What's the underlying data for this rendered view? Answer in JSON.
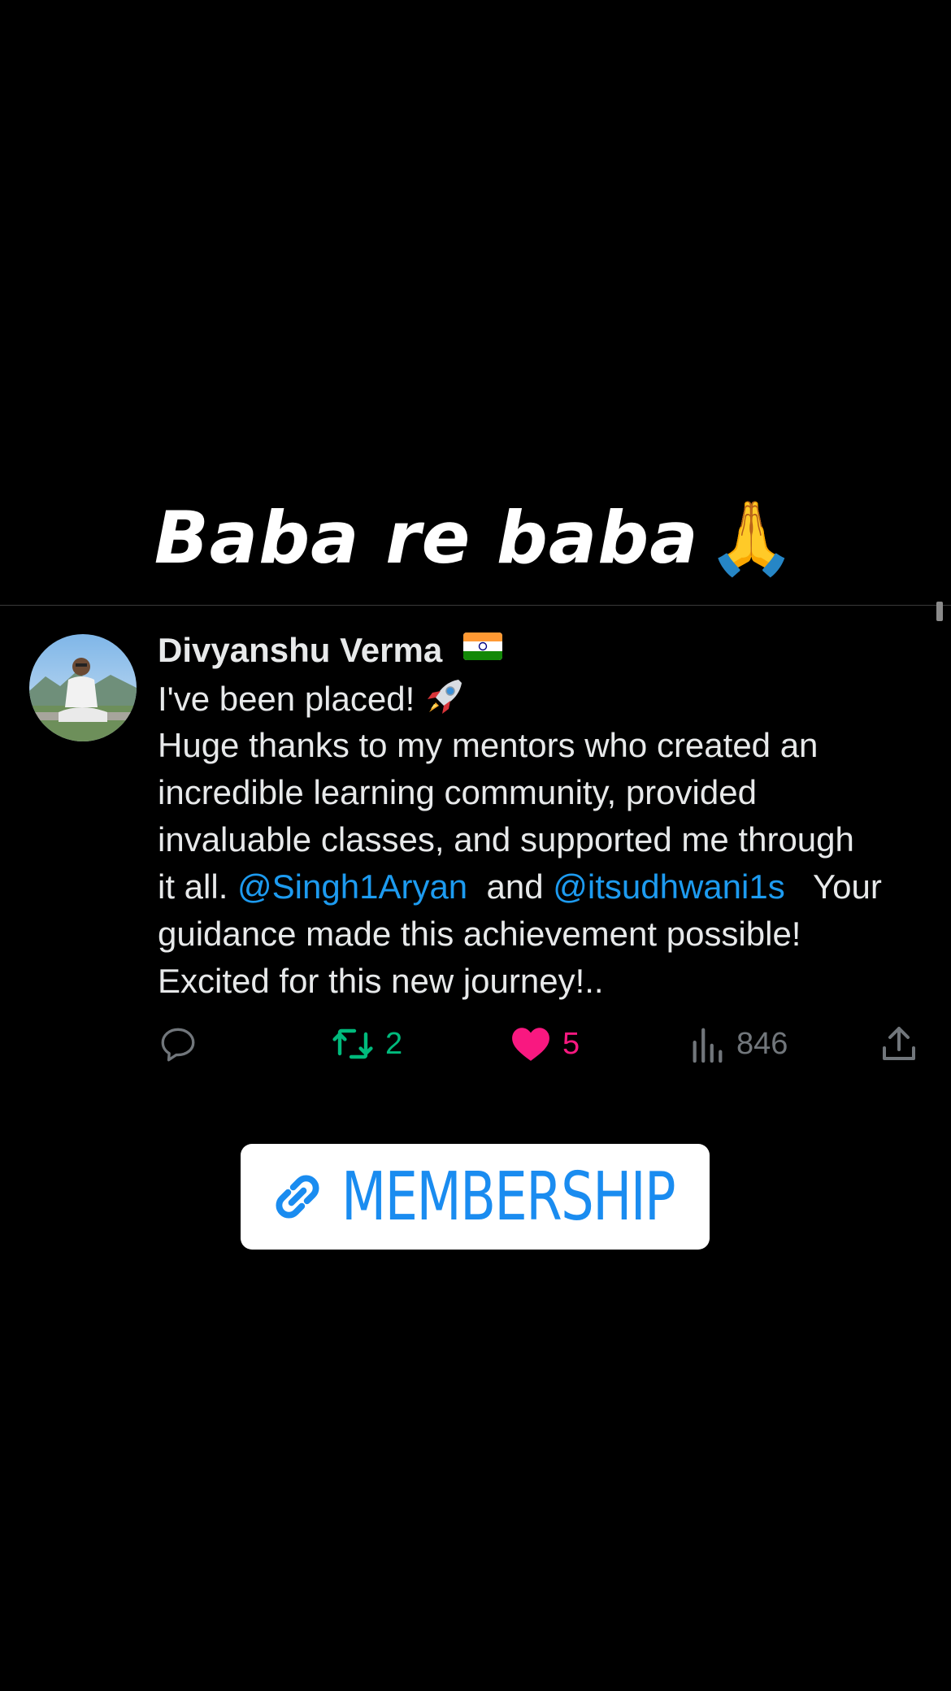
{
  "caption": {
    "text": "Baba re baba",
    "emoji": "🙏"
  },
  "tweet": {
    "author_name": "Divyanshu Verma",
    "author_flag_icon": "india-flag-icon",
    "text_line1": "I've been placed!",
    "text_line2": " Huge thanks to my mentors who created an",
    "text_line3": "incredible learning community, provided",
    "text_line4": "invaluable classes, and supported me through",
    "text_line5_prefix": "it all. ",
    "mention1": "@Singh1Aryan",
    "text_line5_mid": "  and ",
    "mention2": "@itsudhwani1s",
    "text_line5_suffix": "   Your",
    "text_line6": "guidance made this achievement possible!",
    "text_line7": "Excited for this new journey!.."
  },
  "actions": {
    "reply_icon": "reply-icon",
    "retweet_icon": "retweet-icon",
    "retweet_count": "2",
    "like_icon": "heart-icon",
    "like_count": "5",
    "views_icon": "views-icon",
    "views_count": "846",
    "share_icon": "share-icon"
  },
  "membership_button": {
    "label": "MEMBERSHIP",
    "icon": "link-icon"
  },
  "colors": {
    "background": "#000000",
    "text": "#e7e9ea",
    "mention": "#1d9bf0",
    "retweet": "#00ba7c",
    "like": "#f91880",
    "muted": "#71767b",
    "membership_text": "#1a8cf0"
  }
}
